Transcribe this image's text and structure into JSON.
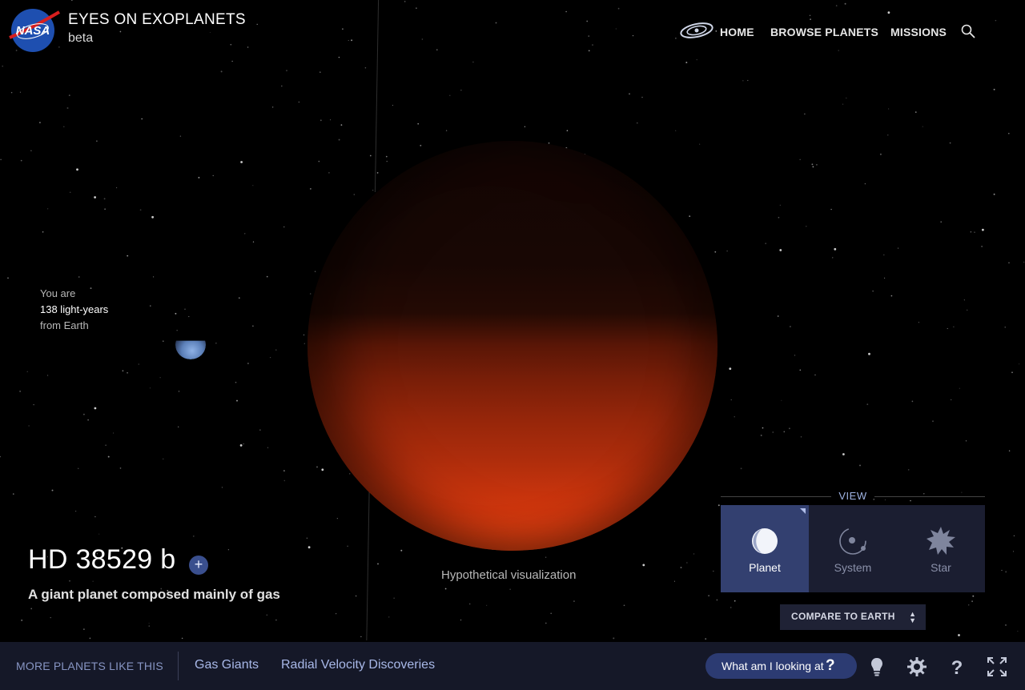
{
  "header": {
    "logo_text": "NASA",
    "title": "EYES ON EXOPLANETS",
    "subtitle": "beta",
    "nav": [
      {
        "label": "HOME"
      },
      {
        "label": "BROWSE PLANETS"
      },
      {
        "label": "MISSIONS"
      }
    ]
  },
  "distance": {
    "line1": "You are",
    "line2": "138 light-years",
    "line3": "from Earth"
  },
  "planet": {
    "name": "HD 38529 b",
    "add_label": "+",
    "description": "A giant planet composed mainly of gas",
    "caption": "Hypothetical visualization",
    "colors": {
      "top": "#180604",
      "bottom": "#f04612"
    }
  },
  "view": {
    "label": "VIEW",
    "options": [
      {
        "label": "Planet",
        "active": true
      },
      {
        "label": "System",
        "active": false
      },
      {
        "label": "Star",
        "active": false
      }
    ],
    "compare_label": "COMPARE TO EARTH"
  },
  "bottom": {
    "more_label": "MORE PLANETS LIKE THIS",
    "links": [
      {
        "label": "Gas Giants"
      },
      {
        "label": "Radial Velocity Discoveries"
      }
    ],
    "what_label": "What am I looking at",
    "what_icon": "?",
    "tools": [
      "lightbulb-icon",
      "settings-icon",
      "help-icon",
      "fullscreen-icon"
    ]
  },
  "colors": {
    "accent": "#334070",
    "bar": "#151828",
    "link": "#a8b8e8"
  }
}
